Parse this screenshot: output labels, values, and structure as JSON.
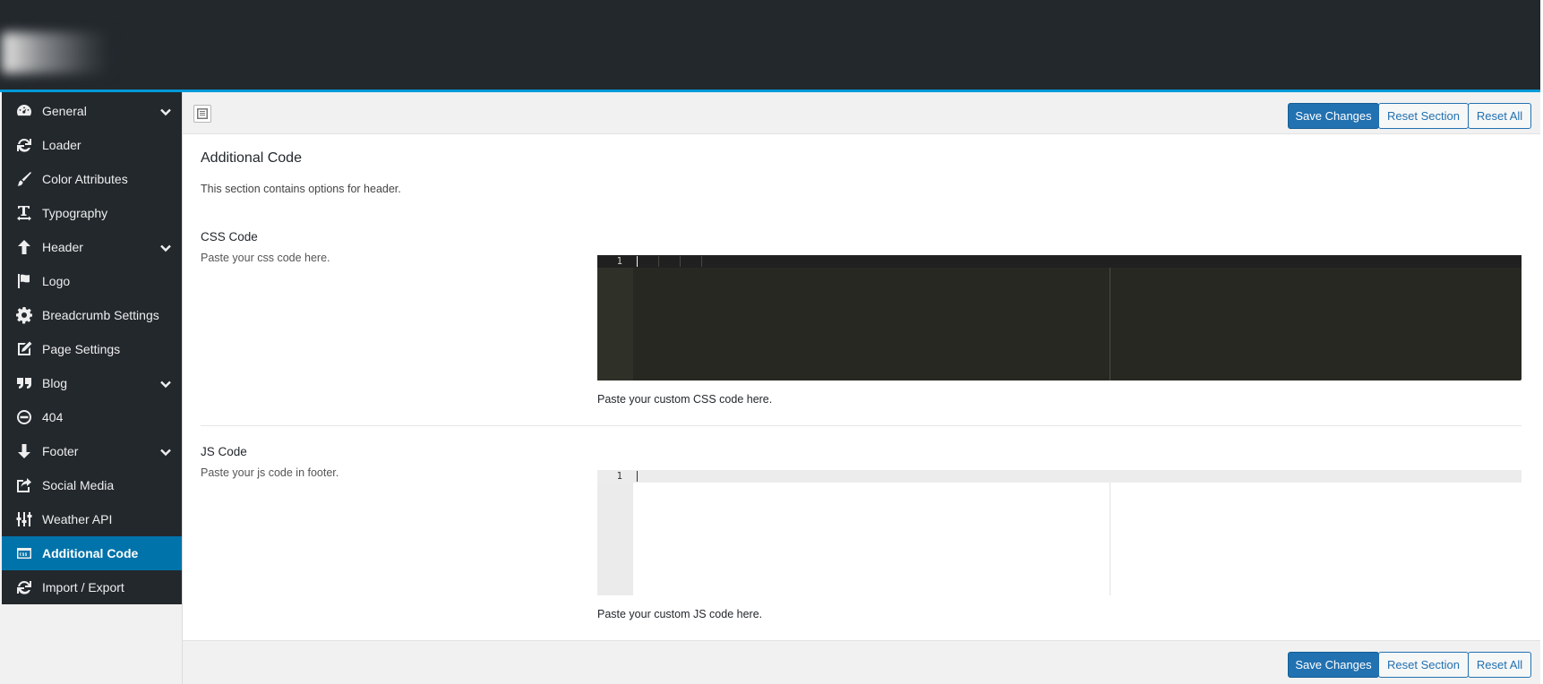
{
  "theme": {
    "sidebar_bg": "#23282d",
    "accent": "#0099d8",
    "active_item_bg": "#0073aa",
    "primary_button": "#2271b1"
  },
  "sidebar": {
    "items": [
      {
        "label": "General",
        "icon": "dashboard-icon",
        "has_submenu": true
      },
      {
        "label": "Loader",
        "icon": "refresh-icon",
        "has_submenu": false
      },
      {
        "label": "Color Attributes",
        "icon": "brush-icon",
        "has_submenu": false
      },
      {
        "label": "Typography",
        "icon": "text-size-icon",
        "has_submenu": false
      },
      {
        "label": "Header",
        "icon": "arrow-up-icon",
        "has_submenu": true
      },
      {
        "label": "Logo",
        "icon": "flag-icon",
        "has_submenu": false
      },
      {
        "label": "Breadcrumb Settings",
        "icon": "gear-icon",
        "has_submenu": false
      },
      {
        "label": "Page Settings",
        "icon": "edit-icon",
        "has_submenu": false
      },
      {
        "label": "Blog",
        "icon": "quote-icon",
        "has_submenu": true
      },
      {
        "label": "404",
        "icon": "minus-circle-icon",
        "has_submenu": false
      },
      {
        "label": "Footer",
        "icon": "arrow-down-icon",
        "has_submenu": true
      },
      {
        "label": "Social Media",
        "icon": "share-icon",
        "has_submenu": false
      },
      {
        "label": "Weather API",
        "icon": "sliders-icon",
        "has_submenu": false
      },
      {
        "label": "Additional Code",
        "icon": "css-icon",
        "has_submenu": false,
        "active": true
      },
      {
        "label": "Import / Export",
        "icon": "refresh-icon",
        "has_submenu": false
      }
    ]
  },
  "toolbar": {
    "save": "Save Changes",
    "reset_section": "Reset Section",
    "reset_all": "Reset All"
  },
  "section": {
    "title": "Additional Code",
    "description": "This section contains options for header."
  },
  "fields": {
    "css": {
      "title": "CSS Code",
      "subtitle": "Paste your css code here.",
      "line_number": "1",
      "help": "Paste your custom CSS code here."
    },
    "js": {
      "title": "JS Code",
      "subtitle": "Paste your js code in footer.",
      "line_number": "1",
      "help": "Paste your custom JS code here."
    }
  }
}
